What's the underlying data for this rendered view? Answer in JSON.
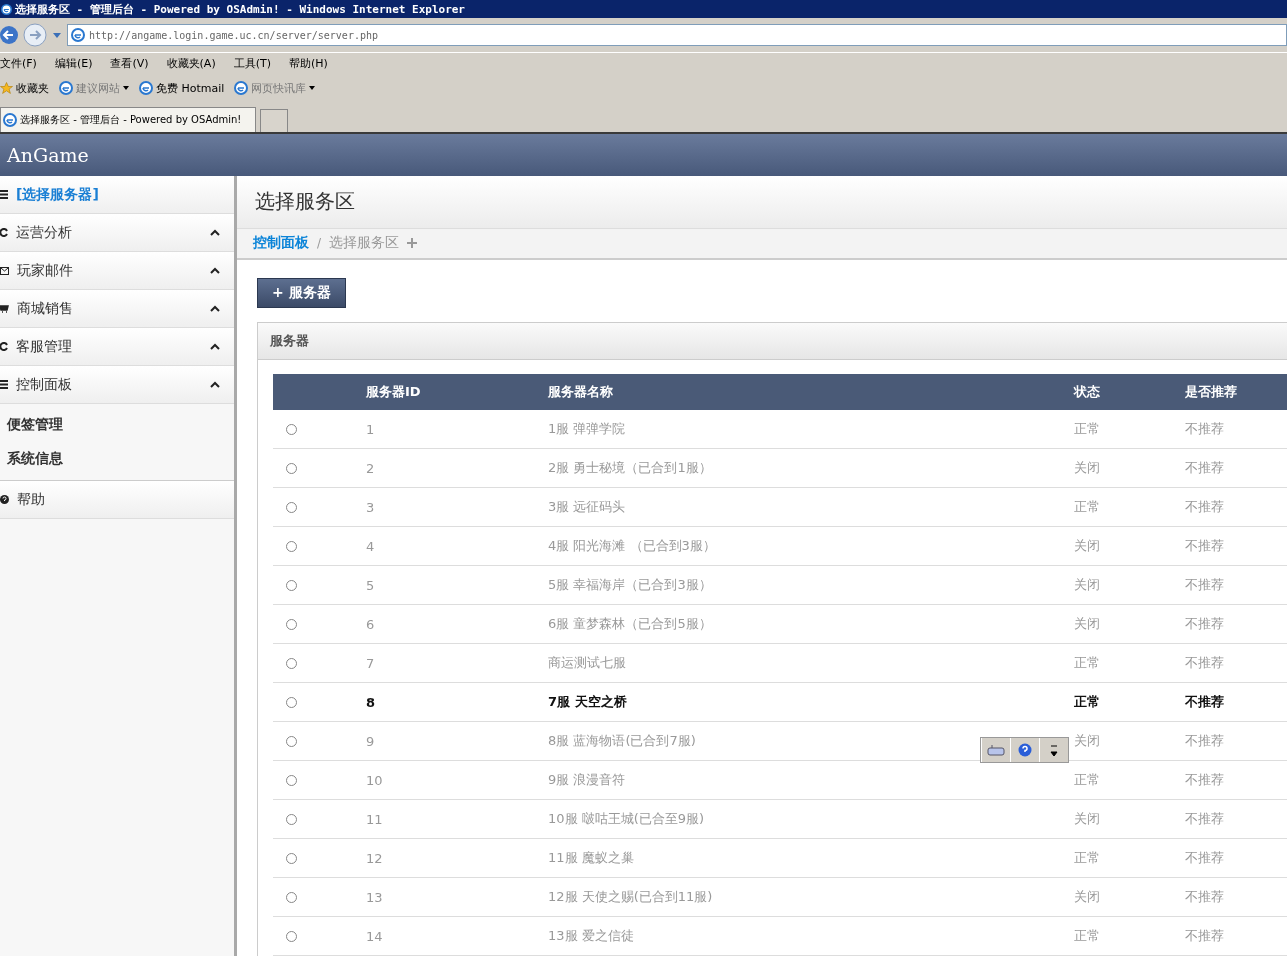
{
  "window": {
    "title": "选择服务区 - 管理后台 - Powered by OSAdmin! - Windows Internet Explorer"
  },
  "address_bar": {
    "value": "http://angame.login.game.uc.cn/server/server.php"
  },
  "menu_bar": [
    "文件(F)",
    "编辑(E)",
    "查看(V)",
    "收藏夹(A)",
    "工具(T)",
    "帮助(H)"
  ],
  "favorites_bar": [
    {
      "label": "收藏夹",
      "kind": "star"
    },
    {
      "label": "建议网站",
      "kind": "dropdown"
    },
    {
      "label": "免费 Hotmail",
      "kind": "page"
    },
    {
      "label": "网页快讯库",
      "kind": "dropdown"
    }
  ],
  "tabs": [
    {
      "label": "选择服务区 - 管理后台 - Powered by OSAdmin!",
      "selected": true
    }
  ],
  "app": {
    "brand": "AnGame"
  },
  "sidebar": {
    "items": [
      {
        "label": "[选择服务器]",
        "kind": "link",
        "selected": true
      },
      {
        "label": "运营分析",
        "kind": "group"
      },
      {
        "label": "玩家邮件",
        "kind": "group"
      },
      {
        "label": "商城销售",
        "kind": "group"
      },
      {
        "label": "客服管理",
        "kind": "group"
      },
      {
        "label": "控制面板",
        "kind": "group",
        "children": [
          {
            "label": "便签管理"
          },
          {
            "label": "系统信息"
          }
        ]
      },
      {
        "label": "帮助",
        "kind": "plain"
      }
    ]
  },
  "page_title": "选择服务区",
  "breadcrumb_separator": "/",
  "breadcrumb": [
    {
      "label": "控制面板",
      "kind": "link"
    },
    {
      "label": "选择服务区",
      "kind": "current"
    }
  ],
  "add_button": "+ 服务器",
  "panel": {
    "title": "服务器",
    "table": {
      "columns": [
        "服务器ID",
        "服务器名称",
        "状态",
        "是否推荐"
      ],
      "rows": [
        {
          "selected": false,
          "highlighted": false,
          "cells": [
            "1",
            "1服 弹弹学院",
            "正常",
            "不推荐"
          ]
        },
        {
          "selected": false,
          "highlighted": false,
          "cells": [
            "2",
            "2服 勇士秘境（已合到1服）",
            "关闭",
            "不推荐"
          ]
        },
        {
          "selected": false,
          "highlighted": false,
          "cells": [
            "3",
            "3服 远征码头",
            "正常",
            "不推荐"
          ]
        },
        {
          "selected": false,
          "highlighted": false,
          "cells": [
            "4",
            "4服 阳光海滩 （已合到3服）",
            "关闭",
            "不推荐"
          ]
        },
        {
          "selected": false,
          "highlighted": false,
          "cells": [
            "5",
            "5服 幸福海岸（已合到3服）",
            "关闭",
            "不推荐"
          ]
        },
        {
          "selected": false,
          "highlighted": false,
          "cells": [
            "6",
            "6服 童梦森林（已合到5服）",
            "关闭",
            "不推荐"
          ]
        },
        {
          "selected": false,
          "highlighted": false,
          "cells": [
            "7",
            "商运测试七服",
            "正常",
            "不推荐"
          ]
        },
        {
          "selected": false,
          "highlighted": true,
          "cells": [
            "8",
            "7服 天空之桥",
            "正常",
            "不推荐"
          ]
        },
        {
          "selected": false,
          "highlighted": false,
          "cells": [
            "9",
            "8服 蓝海物语(已合到7服)",
            "关闭",
            "不推荐"
          ]
        },
        {
          "selected": false,
          "highlighted": false,
          "cells": [
            "10",
            "9服 浪漫音符",
            "正常",
            "不推荐"
          ]
        },
        {
          "selected": false,
          "highlighted": false,
          "cells": [
            "11",
            "10服 啵咕王城(已合至9服)",
            "关闭",
            "不推荐"
          ]
        },
        {
          "selected": false,
          "highlighted": false,
          "cells": [
            "12",
            "11服 魔蚁之巢",
            "正常",
            "不推荐"
          ]
        },
        {
          "selected": false,
          "highlighted": false,
          "cells": [
            "13",
            "12服 天使之赐(已合到11服)",
            "关闭",
            "不推荐"
          ]
        },
        {
          "selected": false,
          "highlighted": false,
          "cells": [
            "14",
            "13服 爱之信徒",
            "正常",
            "不推荐"
          ]
        }
      ]
    }
  }
}
